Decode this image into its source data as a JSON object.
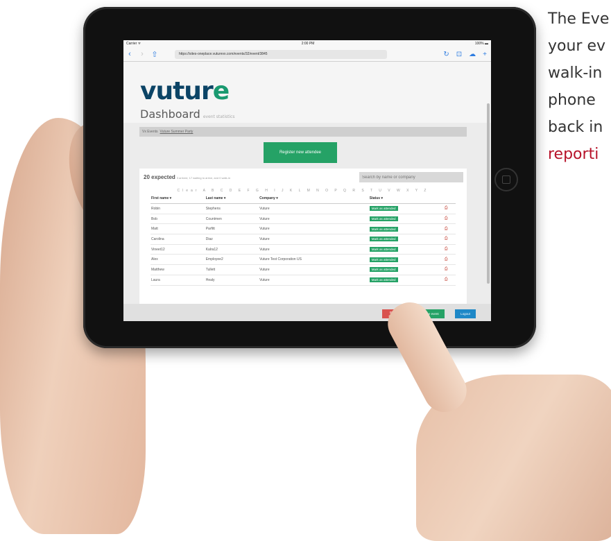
{
  "side_text": {
    "lines": [
      "The Eve",
      "your ev",
      "walk-in",
      "phone",
      "back in"
    ],
    "accent": "reporti"
  },
  "status_bar": {
    "carrier": "Carrier ᯤ",
    "time": "2:00 PM",
    "battery": "100% ▬"
  },
  "browser": {
    "url": "https://sites-oneplace.vuturevx.com/events/32/event/3845",
    "back_icon": "‹",
    "forward_icon": "›",
    "share_icon": "⇧",
    "reload_icon": "↻",
    "book_icon": "⊡",
    "cloud_icon": "☁",
    "add_icon": "+"
  },
  "app": {
    "logo_main": "vutu",
    "logo_accent": "r",
    "logo_end": "e",
    "page_title": "Dashboard",
    "page_subtitle": "event statistics",
    "breadcrumb_prefix": "Vx Events",
    "breadcrumb_link": "Vuture Summer Party",
    "register_label": "Register new attendee",
    "expected_count": "20 expected",
    "expected_detail": "3 arrived, 17 waiting to arrive, and 0 walk-in",
    "search_placeholder": "Search by name or company",
    "alphabet": "Clear A B C D E F G H I J K L M N O P Q R S T U V W X Y Z",
    "columns": [
      "First name ▾",
      "Last name ▾",
      "Company ▾",
      "Status ▾",
      ""
    ],
    "rows": [
      {
        "first": "Robin",
        "last": "Stephens",
        "company": "Vuture",
        "status": "Mark as attended"
      },
      {
        "first": "Bob",
        "last": "Countmen",
        "company": "Vuture",
        "status": "Mark as attended"
      },
      {
        "first": "Matt",
        "last": "Parfitt",
        "company": "Vuture",
        "status": "Mark as attended"
      },
      {
        "first": "Carolina",
        "last": "Diaz",
        "company": "Vuture",
        "status": "Mark as attended"
      },
      {
        "first": "Vineet12",
        "last": "Kalra12",
        "company": "Vuture",
        "status": "Mark as attended"
      },
      {
        "first": "Alex",
        "last": "Employee2",
        "company": "Vuture Test Corporation US",
        "status": "Mark as attended"
      },
      {
        "first": "Matthew",
        "last": "Tullett",
        "company": "Vuture",
        "status": "Mark as attended"
      },
      {
        "first": "Laura",
        "last": "Healy",
        "company": "Vuture",
        "status": "Mark as attended"
      }
    ],
    "footer": {
      "end_label": "End event",
      "continue_label": "⊙ Continue event",
      "logout_label": "Logout"
    }
  },
  "colors": {
    "brand_navy": "#0c4466",
    "brand_green": "#25a266",
    "end_red": "#d9534f",
    "logout_blue": "#1e88c7",
    "accent_red": "#b7132a"
  }
}
